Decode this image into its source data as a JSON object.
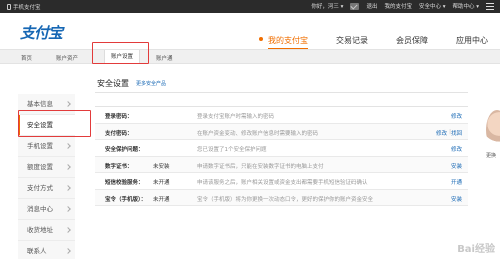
{
  "topbar": {
    "left_label": "手机支付宝",
    "greeting": "你好，河三 ▾",
    "logout": "退出",
    "my_alipay": "我的支付宝",
    "security_center": "安全中心 ▾",
    "help_center": "帮助中心 ▾"
  },
  "header": {
    "logo": "支付宝",
    "nav": [
      "我的支付宝",
      "交易记录",
      "会员保障",
      "应用中心"
    ]
  },
  "subnav": {
    "items": [
      "首页",
      "账户资产",
      "账户设置",
      "账户通"
    ]
  },
  "sidebar": {
    "items": [
      "基本信息",
      "安全设置",
      "手机设置",
      "额度设置",
      "支付方式",
      "消息中心",
      "收货地址",
      "联系人"
    ]
  },
  "main": {
    "title": "安全设置",
    "more_link": "更多安全产品"
  },
  "security_rows": [
    {
      "label": "登录密码：",
      "status": "",
      "desc": "登录支付宝账户时需输入的密码",
      "action": "修改",
      "action2": ""
    },
    {
      "label": "支付密码：",
      "status": "",
      "desc": "在账户资金变动、修改账户信息时需要输入的密码",
      "action": "找回",
      "action2": "修改"
    },
    {
      "label": "安全保护问题：",
      "status": "",
      "desc": "您已设置了1个安全保护问题",
      "action": "修改",
      "action2": ""
    },
    {
      "label": "数字证书：",
      "status": "未安装",
      "desc": "申请数字证书后，只能在安装数字证书的电脑上支付",
      "action": "安装",
      "action2": ""
    },
    {
      "label": "短信校验服务：",
      "status": "未开通",
      "desc": "申请该服务之后，账户相关设置或资金支出都需要手机短信验证码确认",
      "action": "开通",
      "action2": ""
    },
    {
      "label": "宝令（手机版）：",
      "status": "未开通",
      "desc": "宝令（手机版）将为你更换一次动态口令，更好的保护你的账户资金安全",
      "action": "安装",
      "action2": ""
    }
  ],
  "right_panel": {
    "label": "更换"
  },
  "watermark": "Bai经验"
}
